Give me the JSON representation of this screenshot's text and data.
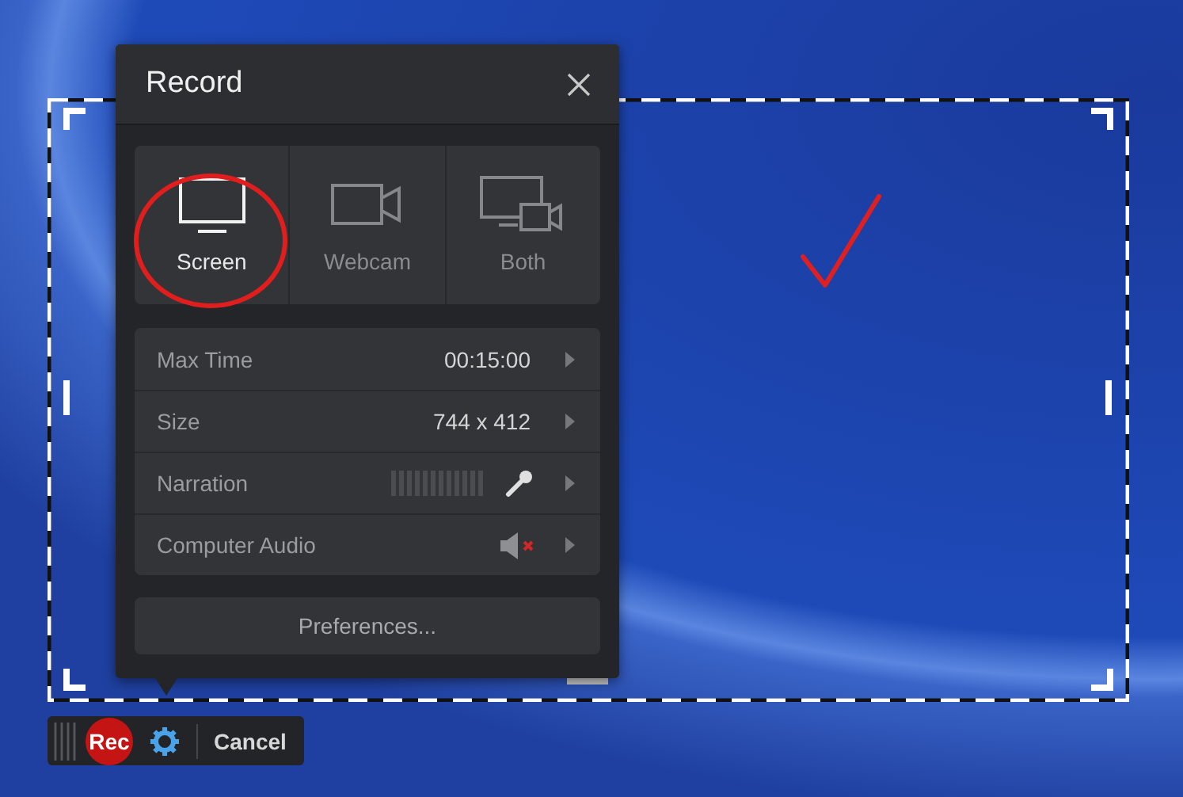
{
  "dialog": {
    "title": "Record"
  },
  "modes": [
    {
      "kind": "screen",
      "label": "Screen",
      "selected": true
    },
    {
      "kind": "webcam",
      "label": "Webcam",
      "selected": false
    },
    {
      "kind": "both",
      "label": "Both",
      "selected": false
    }
  ],
  "settings": [
    {
      "kind": "value",
      "label": "Max Time",
      "value": "00:15:00"
    },
    {
      "kind": "value",
      "label": "Size",
      "value": "744 x 412"
    },
    {
      "kind": "narration",
      "label": "Narration"
    },
    {
      "kind": "audio",
      "label": "Computer Audio",
      "muted": true
    }
  ],
  "preferences": "Preferences...",
  "toolbar": {
    "record": "Rec",
    "cancel": "Cancel"
  }
}
